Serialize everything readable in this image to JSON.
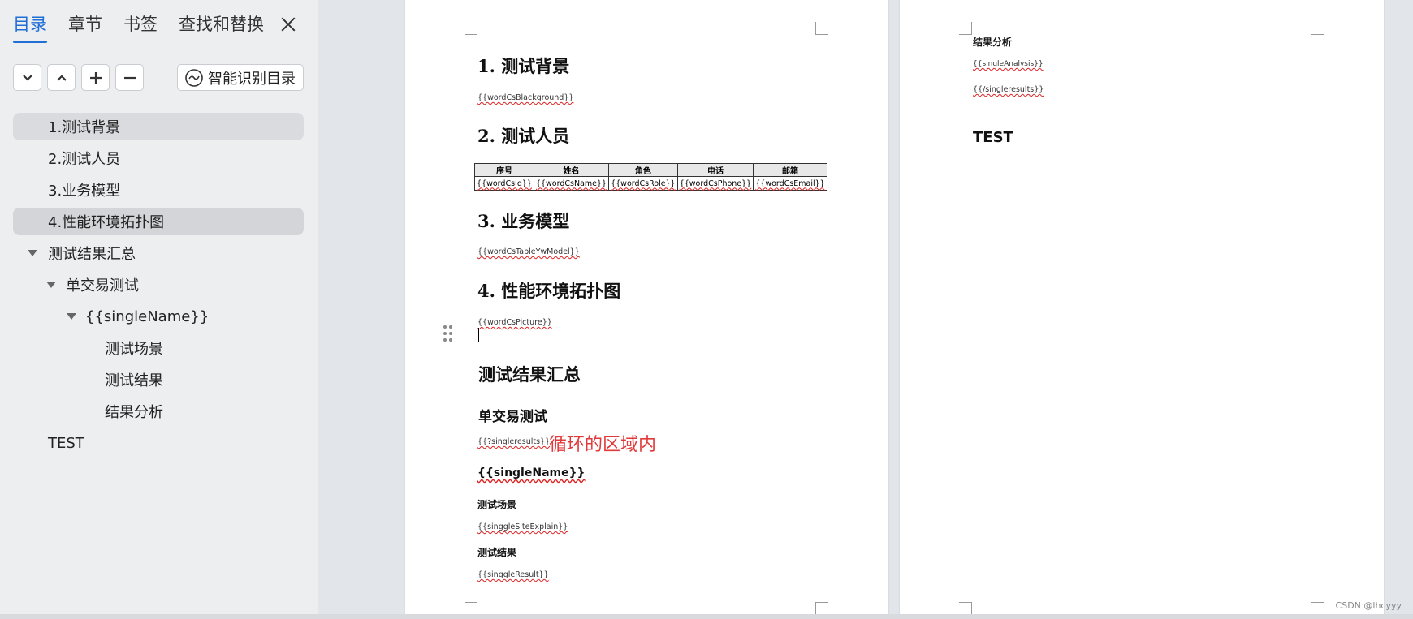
{
  "sidebar": {
    "tabs": [
      "目录",
      "章节",
      "书签",
      "查找和替换"
    ],
    "smart_button": "智能识别目录",
    "toc": [
      {
        "label": "1.测试背景"
      },
      {
        "label": "2.测试人员"
      },
      {
        "label": "3.业务模型"
      },
      {
        "label": "4.性能环境拓扑图"
      },
      {
        "label": "测试结果汇总"
      },
      {
        "label": "单交易测试"
      },
      {
        "label": "{{singleName}}"
      },
      {
        "label": "测试场景"
      },
      {
        "label": "测试结果"
      },
      {
        "label": "结果分析"
      },
      {
        "label": "TEST"
      }
    ]
  },
  "page1": {
    "h1_1": "1. 测试背景",
    "tag_bg": "{{wordCsBlackground}}",
    "h1_2": "2. 测试人员",
    "table": {
      "headers": [
        "序号",
        "姓名",
        "角色",
        "电话",
        "邮箱"
      ],
      "row": [
        "{{wordCsId}}",
        "{{wordCsName}}",
        "{{wordCsRole}}",
        "{{wordCsPhone}}",
        "{{wordCsEmail}}"
      ]
    },
    "h1_3": "3. 业务模型",
    "tag_model": "{{wordCsTableYwModel}}",
    "h1_4": "4. 性能环境拓扑图",
    "tag_pic": "{{wordCsPicture}}",
    "h_summary": "测试结果汇总",
    "h_single": "单交易测试",
    "tag_results_open": "{{?singleresults}}",
    "red_note": "循环的区域内",
    "single_name": "{{singleName}}",
    "h_scene": "测试场景",
    "tag_scene": "{{singgleSiteExplain}}",
    "h_result": "测试结果",
    "tag_result": "{{singgleResult}}"
  },
  "page2": {
    "h_analysis": "结果分析",
    "tag_analysis": "{{singleAnalysis}}",
    "tag_results_close": "{{/singleresults}}",
    "test": "TEST"
  },
  "watermark": "CSDN @lhcyyy",
  "colors": {
    "accent": "#1f6fd6",
    "note_red": "#e03a3a"
  }
}
